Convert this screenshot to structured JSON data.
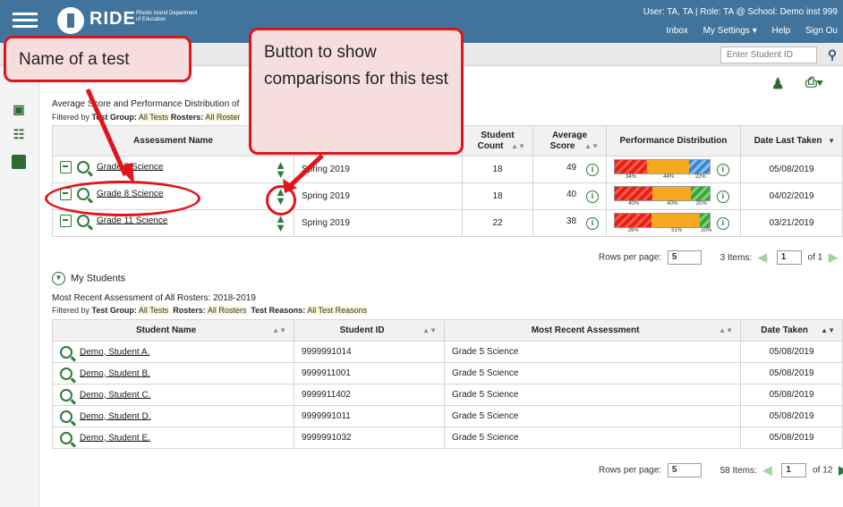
{
  "header": {
    "brand": "RIDE",
    "brand_sub": "Rhode Island Department of Education",
    "user_info": "User: TA, TA  |  Role: TA @ School: Demo inst 999",
    "links": [
      "Inbox",
      "My Settings ▾",
      "Help",
      "Sign Ou"
    ]
  },
  "student_id_input": {
    "placeholder": "Enter Student ID"
  },
  "assessments_section": {
    "title_partial": "Average Score and Performance Distribution of",
    "filter": {
      "prefix": "Filtered by",
      "group_label": "Test Group:",
      "group_value": "All Tests",
      "rosters_label": "Rosters:",
      "rosters_value": "All Roster"
    },
    "columns": [
      "Assessment Name",
      "",
      "Student Count",
      "Average Score",
      "Performance Distribution",
      "Date Last Taken"
    ],
    "rows": [
      {
        "name": "Grade 5 Science",
        "period": "Spring 2019",
        "count": "18",
        "avg": "49",
        "date": "05/08/2019",
        "dist": [
          {
            "level": "red",
            "pct": 34,
            "label": "34%"
          },
          {
            "level": "yel",
            "pct": 44,
            "label": "44%"
          },
          {
            "level": "blu",
            "pct": 22,
            "label": "22%"
          }
        ]
      },
      {
        "name": "Grade 8 Science",
        "period": "Spring 2019",
        "count": "18",
        "avg": "40",
        "date": "04/02/2019",
        "dist": [
          {
            "level": "red",
            "pct": 40,
            "label": "40%"
          },
          {
            "level": "yel",
            "pct": 40,
            "label": "40%"
          },
          {
            "level": "grn",
            "pct": 20,
            "label": "20%"
          }
        ]
      },
      {
        "name": "Grade 11 Science",
        "period": "Spring 2019",
        "count": "22",
        "avg": "38",
        "date": "03/21/2019",
        "dist": [
          {
            "level": "red",
            "pct": 39,
            "label": "39%"
          },
          {
            "level": "yel",
            "pct": 51,
            "label": "51%"
          },
          {
            "level": "grn",
            "pct": 10,
            "label": "10%"
          }
        ]
      }
    ],
    "pager": {
      "rows_label": "Rows per page:",
      "rows_value": "5",
      "items": "3 Items:",
      "page": "1",
      "of": "of 1"
    }
  },
  "students_section": {
    "title": "My Students",
    "subtitle": "Most Recent Assessment of All Rosters: 2018-2019",
    "filter": {
      "prefix": "Filtered by",
      "group_label": "Test Group:",
      "group_value": "All Tests",
      "rosters_label": "Rosters:",
      "rosters_value": "All Rosters",
      "reasons_label": "Test Reasons:",
      "reasons_value": "All Test Reasons"
    },
    "columns": [
      "Student Name",
      "Student ID",
      "Most Recent Assessment",
      "Date Taken"
    ],
    "rows": [
      {
        "name": "Demo, Student A.",
        "id": "9999991014",
        "assessment": "Grade 5 Science",
        "date": "05/08/2019"
      },
      {
        "name": "Demo, Student B.",
        "id": "9999911001",
        "assessment": "Grade 5 Science",
        "date": "05/08/2019"
      },
      {
        "name": "Demo, Student C.",
        "id": "9999911402",
        "assessment": "Grade 5 Science",
        "date": "05/08/2019"
      },
      {
        "name": "Demo, Student D.",
        "id": "9999991011",
        "assessment": "Grade 5 Science",
        "date": "05/08/2019"
      },
      {
        "name": "Demo, Student E.",
        "id": "9999991032",
        "assessment": "Grade 5 Science",
        "date": "05/08/2019"
      }
    ],
    "pager": {
      "rows_label": "Rows per page:",
      "rows_value": "5",
      "items": "58 Items:",
      "page": "1",
      "of": "of 12"
    }
  },
  "callouts": {
    "name_of_test": "Name of a test",
    "compare_button": "Button to show comparisons for this test"
  },
  "colors": {
    "header": "#41749c",
    "accent_green": "#2c7a3a",
    "callout_red": "#e0141b"
  }
}
